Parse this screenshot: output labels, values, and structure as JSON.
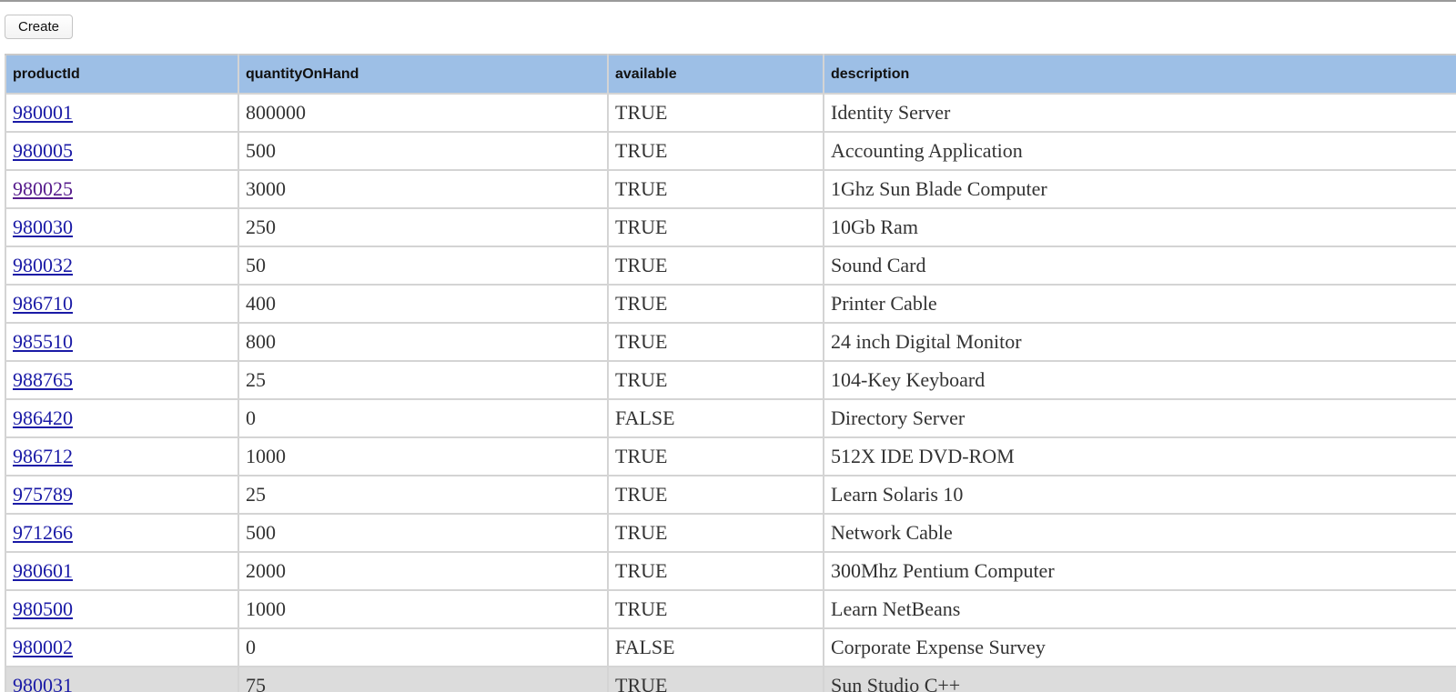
{
  "toolbar": {
    "create_label": "Create"
  },
  "table": {
    "columns": [
      "productId",
      "quantityOnHand",
      "available",
      "description"
    ],
    "rows": [
      {
        "productId": "980001",
        "quantityOnHand": "800000",
        "available": "TRUE",
        "description": "Identity Server"
      },
      {
        "productId": "980005",
        "quantityOnHand": "500",
        "available": "TRUE",
        "description": "Accounting Application"
      },
      {
        "productId": "980025",
        "quantityOnHand": "3000",
        "available": "TRUE",
        "description": "1Ghz Sun Blade Computer",
        "visited": true
      },
      {
        "productId": "980030",
        "quantityOnHand": "250",
        "available": "TRUE",
        "description": "10Gb Ram"
      },
      {
        "productId": "980032",
        "quantityOnHand": "50",
        "available": "TRUE",
        "description": "Sound Card"
      },
      {
        "productId": "986710",
        "quantityOnHand": "400",
        "available": "TRUE",
        "description": "Printer Cable"
      },
      {
        "productId": "985510",
        "quantityOnHand": "800",
        "available": "TRUE",
        "description": "24 inch Digital Monitor"
      },
      {
        "productId": "988765",
        "quantityOnHand": "25",
        "available": "TRUE",
        "description": "104-Key Keyboard"
      },
      {
        "productId": "986420",
        "quantityOnHand": "0",
        "available": "FALSE",
        "description": "Directory Server"
      },
      {
        "productId": "986712",
        "quantityOnHand": "1000",
        "available": "TRUE",
        "description": "512X IDE DVD-ROM"
      },
      {
        "productId": "975789",
        "quantityOnHand": "25",
        "available": "TRUE",
        "description": "Learn Solaris 10"
      },
      {
        "productId": "971266",
        "quantityOnHand": "500",
        "available": "TRUE",
        "description": "Network Cable"
      },
      {
        "productId": "980601",
        "quantityOnHand": "2000",
        "available": "TRUE",
        "description": "300Mhz Pentium Computer"
      },
      {
        "productId": "980500",
        "quantityOnHand": "1000",
        "available": "TRUE",
        "description": "Learn NetBeans"
      },
      {
        "productId": "980002",
        "quantityOnHand": "0",
        "available": "FALSE",
        "description": "Corporate Expense Survey"
      },
      {
        "productId": "980031",
        "quantityOnHand": "75",
        "available": "TRUE",
        "description": "Sun Studio C++",
        "shaded": true
      }
    ]
  },
  "colors": {
    "header_bg": "#9dbfe6",
    "link": "#1a1aa6",
    "visited_link": "#551a8b",
    "shaded_row": "#dcdcdc"
  }
}
